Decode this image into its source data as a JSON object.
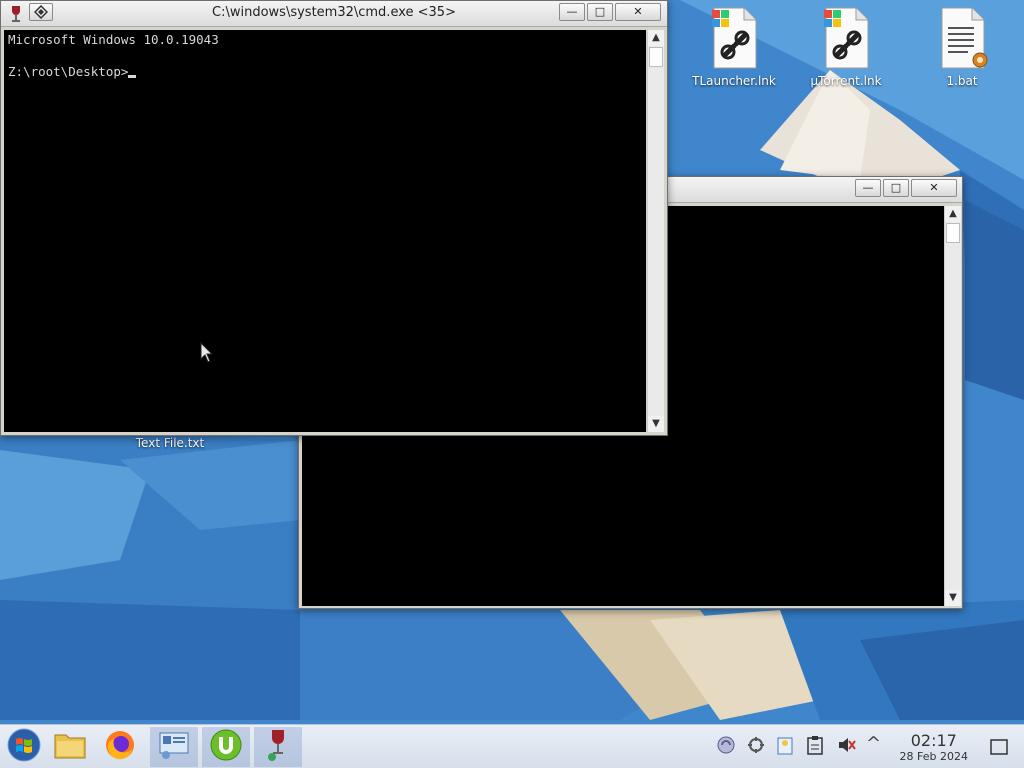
{
  "desktop": {
    "icons": [
      {
        "label": "TLauncher.lnk",
        "icon": "shortcut-icon"
      },
      {
        "label": "µTorrent.lnk",
        "icon": "shortcut-icon"
      },
      {
        "label": "1.bat",
        "icon": "batch-file-icon"
      },
      {
        "label": "Text File.txt",
        "icon": "text-file-icon"
      }
    ]
  },
  "cmd_window": {
    "title": "C:\\windows\\system32\\cmd.exe <35>",
    "line1": "Microsoft Windows 10.0.19043",
    "line2": "",
    "prompt": "Z:\\root\\Desktop>",
    "minimize_label": "—",
    "maximize_label": "□",
    "close_label": "✕"
  },
  "back_window": {
    "title": "",
    "minimize_label": "—",
    "maximize_label": "□",
    "close_label": "✕"
  },
  "scroll": {
    "up": "▲",
    "down": "▼"
  },
  "taskbar": {
    "items": [
      {
        "name": "start",
        "icon": "windows-start-icon"
      },
      {
        "name": "file-manager",
        "icon": "folder-icon"
      },
      {
        "name": "firefox",
        "icon": "firefox-icon"
      },
      {
        "name": "control-panel",
        "icon": "control-panel-icon"
      },
      {
        "name": "utorrent",
        "icon": "utorrent-icon"
      },
      {
        "name": "wine",
        "icon": "wine-icon"
      }
    ],
    "tray": {
      "show_hidden": "^"
    },
    "clock": {
      "time": "02:17",
      "date": "28 Feb 2024"
    }
  },
  "colors": {
    "console_bg": "#000000",
    "console_fg": "#d8d8d8",
    "taskbar_bg": "#e3e9f3",
    "utorrent_green": "#6bbf2a"
  }
}
